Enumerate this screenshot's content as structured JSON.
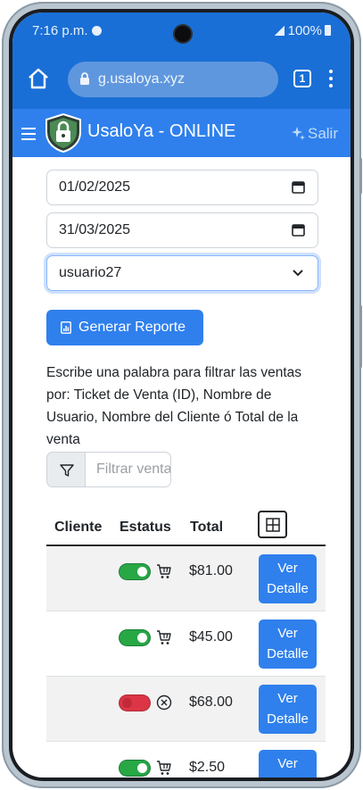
{
  "status_bar": {
    "time": "7:16 p.m.",
    "battery": "100%"
  },
  "browser": {
    "url": "g.usaloya.xyz",
    "tab_count": "1"
  },
  "navbar": {
    "brand": "UsaloYa - ONLINE",
    "logout_label": "Salir"
  },
  "form": {
    "start_date": "01/02/2025",
    "end_date": "31/03/2025",
    "user_selected": "usuario27",
    "report_button": "Generar Reporte"
  },
  "filter": {
    "help_text": "Escribe una palabra para filtrar las ventas por: Ticket de Venta (ID), Nombre de Usuario, Nombre del Cliente ó Total de la venta",
    "placeholder": "Filtrar ventas"
  },
  "table": {
    "headers": {
      "cliente": "Cliente",
      "estatus": "Estatus",
      "total": "Total"
    },
    "detail_label": "Ver Detalle",
    "rows": [
      {
        "cliente": "",
        "active": true,
        "status_icon": "cart-icon",
        "total": "$81.00"
      },
      {
        "cliente": "",
        "active": true,
        "status_icon": "cart-icon",
        "total": "$45.00"
      },
      {
        "cliente": "",
        "active": false,
        "status_icon": "cancel-circle-icon",
        "total": "$68.00"
      },
      {
        "cliente": "",
        "active": true,
        "status_icon": "cart-icon",
        "total": "$2.50"
      }
    ]
  },
  "colors": {
    "chrome": "#1a6fd6",
    "navbar": "#2f80ed",
    "primary": "#2f80ed",
    "success": "#28a745",
    "danger": "#dc3545"
  }
}
